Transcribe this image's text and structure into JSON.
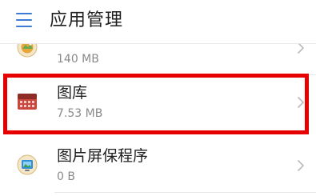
{
  "header": {
    "title": "应用管理",
    "menu_icon": "hamburger-menu-icon",
    "accent": "#3a7bd5"
  },
  "apps": [
    {
      "name": "",
      "size": "140 MB",
      "icon": "travel-app-icon",
      "chevron_icon": "chevron-right-icon"
    },
    {
      "name": "图库",
      "size": "7.53 MB",
      "icon": "gallery-icon",
      "chevron_icon": "chevron-right-icon"
    },
    {
      "name": "图片屏保程序",
      "size": "0 B",
      "icon": "screensaver-icon",
      "chevron_icon": "chevron-right-icon"
    }
  ],
  "highlight": {
    "color": "#e60000"
  }
}
